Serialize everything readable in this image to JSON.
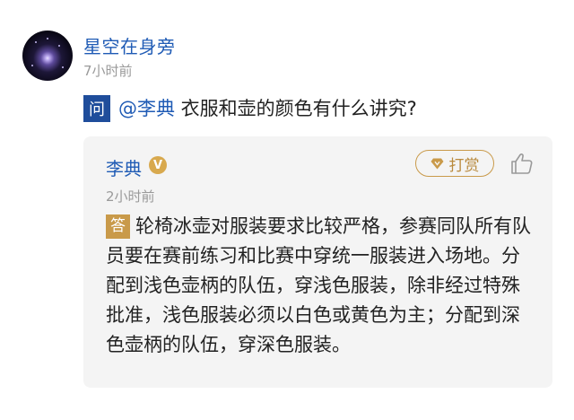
{
  "post": {
    "username": "星空在身旁",
    "time": "7小时前"
  },
  "question": {
    "badge": "问",
    "mention": "@李典",
    "text": " 衣服和壶的颜色有什么讲究?"
  },
  "answer": {
    "author": "李典",
    "verified_badge": "V",
    "tip_label": "打赏",
    "time": "2小时前",
    "badge": "答",
    "text": "轮椅冰壶对服装要求比较严格，参赛同队所有队员要在赛前练习和比赛中穿统一服装进入场地。分配到浅色壶柄的队伍，穿浅色服装，除非经过特殊批准，浅色服装必须以白色或黄色为主；分配到深色壶柄的队伍，穿深色服装。"
  },
  "colors": {
    "link_blue": "#1f5bb5",
    "question_badge": "#1f4d9b",
    "accent_gold": "#c99a4a",
    "card_bg": "#f4f4f4",
    "meta_gray": "#9a9a9a"
  },
  "icons": [
    "avatar-starfield",
    "verified-v-icon",
    "gem-icon",
    "thumbs-up-icon"
  ]
}
